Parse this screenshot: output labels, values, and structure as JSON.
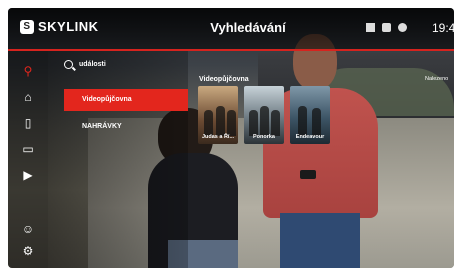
{
  "app": {
    "brand": "SKYLINK",
    "title": "Vyhledávání",
    "clock": "19:4"
  },
  "search": {
    "query": "události"
  },
  "categories": [
    {
      "label": "Videopůjčovna",
      "selected": true
    },
    {
      "label": "NAHRÁVKY",
      "selected": false
    }
  ],
  "results": {
    "row_title": "Videopůjčovna",
    "items": [
      {
        "title": "Judas a Ří..."
      },
      {
        "title": "Ponorka"
      },
      {
        "title": "Endeavour"
      }
    ],
    "next_row_label": "Nalezeno"
  },
  "icons": {
    "sidebar": [
      "search-icon",
      "home-icon",
      "book-icon",
      "tv-icon",
      "video-icon",
      "user-icon",
      "settings-icon"
    ],
    "status": [
      "network-icon",
      "monitor-icon",
      "record-icon"
    ]
  },
  "colors": {
    "accent": "#e3261d"
  }
}
